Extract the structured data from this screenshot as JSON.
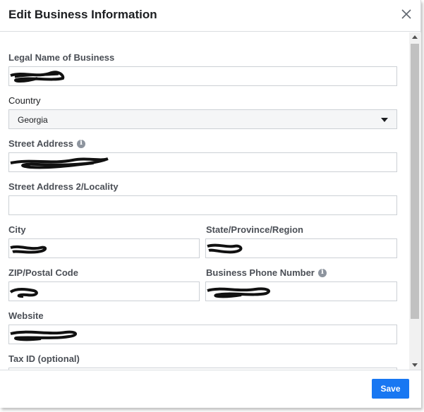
{
  "dialog": {
    "title": "Edit Business Information",
    "close_icon": "close-icon"
  },
  "form": {
    "legal_name_label": "Legal Name of Business",
    "country_label": "Country",
    "country_value": "Georgia",
    "street_label": "Street Address",
    "street2_label": "Street Address 2/Locality",
    "city_label": "City",
    "state_label": "State/Province/Region",
    "zip_label": "ZIP/Postal Code",
    "phone_label": "Business Phone Number",
    "website_label": "Website",
    "tax_label": "Tax ID (optional)"
  },
  "footer": {
    "save_label": "Save"
  },
  "colors": {
    "accent": "#1877f2",
    "label": "#4b4f56",
    "border": "#ccd0d5"
  }
}
